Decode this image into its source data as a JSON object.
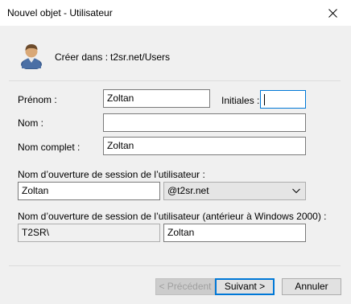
{
  "window": {
    "title": "Nouvel objet - Utilisateur",
    "close_icon": "close-icon"
  },
  "header": {
    "create_in_label": "Créer dans :",
    "create_in_path": "t2sr.net/Users",
    "icon": "user-icon"
  },
  "form": {
    "first_name": {
      "label": "Prénom :",
      "value": "Zoltan"
    },
    "initials": {
      "label": "Initiales :",
      "value": ""
    },
    "last_name": {
      "label": "Nom :",
      "value": ""
    },
    "full_name": {
      "label": "Nom complet :",
      "value": "Zoltan"
    },
    "logon_name": {
      "label": "Nom d’ouverture de session de l’utilisateur :",
      "value": "Zoltan",
      "domain": "@t2sr.net"
    },
    "pre2000": {
      "label": "Nom d’ouverture de session de l’utilisateur (antérieur à Windows 2000) :",
      "domain": "T2SR\\",
      "value": "Zoltan"
    }
  },
  "buttons": {
    "previous": "< Précédent",
    "next": "Suivant >",
    "cancel": "Annuler"
  },
  "colors": {
    "focus": "#0078d7",
    "window_bg": "#f0f0f0"
  }
}
